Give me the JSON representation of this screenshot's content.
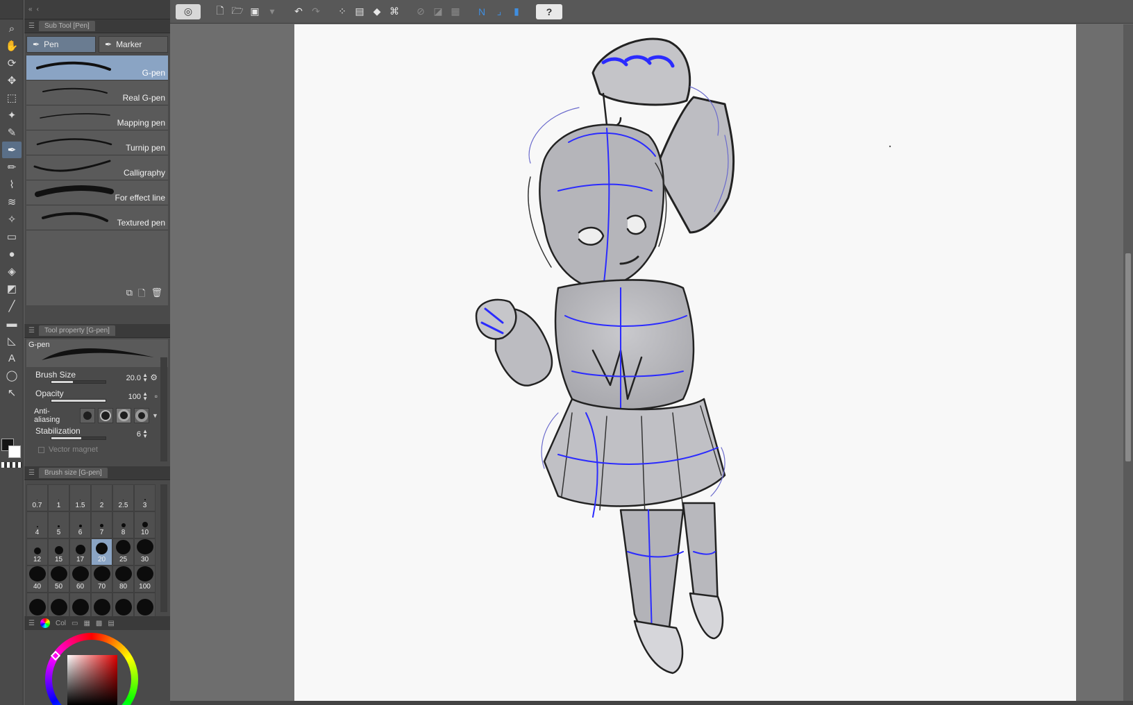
{
  "toolbar": {
    "tools": [
      {
        "name": "zoom-icon",
        "glyph": "⌕"
      },
      {
        "name": "hand-icon",
        "glyph": "✋"
      },
      {
        "name": "rotate-icon",
        "glyph": "⟳"
      },
      {
        "name": "move-icon",
        "glyph": "✥"
      },
      {
        "name": "selection-icon",
        "glyph": "⬚"
      },
      {
        "name": "auto-select-icon",
        "glyph": "✦"
      },
      {
        "name": "eyedropper-icon",
        "glyph": "✎"
      },
      {
        "name": "pen-icon",
        "glyph": "✒",
        "active": true
      },
      {
        "name": "pencil-icon",
        "glyph": "✏"
      },
      {
        "name": "brush-icon",
        "glyph": "⌇"
      },
      {
        "name": "airbrush-icon",
        "glyph": "≋"
      },
      {
        "name": "decoration-icon",
        "glyph": "✧"
      },
      {
        "name": "eraser-icon",
        "glyph": "▭"
      },
      {
        "name": "blend-icon",
        "glyph": "●"
      },
      {
        "name": "fill-icon",
        "glyph": "◈"
      },
      {
        "name": "gradient-icon",
        "glyph": "◩"
      },
      {
        "name": "figure-icon",
        "glyph": "╱"
      },
      {
        "name": "frame-icon",
        "glyph": "▬"
      },
      {
        "name": "ruler-icon",
        "glyph": "◺"
      },
      {
        "name": "text-icon",
        "glyph": "A"
      },
      {
        "name": "balloon-icon",
        "glyph": "◯"
      },
      {
        "name": "correct-line-icon",
        "glyph": "↖"
      }
    ]
  },
  "subtool": {
    "header": "Sub Tool [Pen]",
    "tabs": [
      {
        "label": "Pen",
        "active": true
      },
      {
        "label": "Marker",
        "active": false
      }
    ],
    "items": [
      {
        "label": "G-pen",
        "active": true
      },
      {
        "label": "Real G-pen",
        "active": false
      },
      {
        "label": "Mapping pen",
        "active": false
      },
      {
        "label": "Turnip pen",
        "active": false
      },
      {
        "label": "Calligraphy",
        "active": false
      },
      {
        "label": "For effect line",
        "active": false
      },
      {
        "label": "Textured pen",
        "active": false
      }
    ]
  },
  "toolprop": {
    "header": "Tool property [G-pen]",
    "preview_name": "G-pen",
    "brush_size": {
      "label": "Brush Size",
      "value": "20.0",
      "fill": 0.4
    },
    "opacity": {
      "label": "Opacity",
      "value": "100",
      "fill": 1.0
    },
    "antialiasing": {
      "label": "Anti-aliasing",
      "selected": 2
    },
    "stabilization": {
      "label": "Stabilization",
      "value": "6",
      "fill": 0.55
    },
    "vector_magnet": {
      "label": "Vector magnet"
    }
  },
  "brushsize": {
    "header": "Brush size [G-pen]",
    "selected": "20",
    "sizes": [
      {
        "label": "0.7",
        "d": 1
      },
      {
        "label": "1",
        "d": 1
      },
      {
        "label": "1.5",
        "d": 1
      },
      {
        "label": "2",
        "d": 1
      },
      {
        "label": "2.5",
        "d": 1
      },
      {
        "label": "3",
        "d": 2
      },
      {
        "label": "4",
        "d": 2
      },
      {
        "label": "5",
        "d": 3
      },
      {
        "label": "6",
        "d": 4
      },
      {
        "label": "7",
        "d": 5
      },
      {
        "label": "8",
        "d": 6
      },
      {
        "label": "10",
        "d": 8
      },
      {
        "label": "12",
        "d": 10
      },
      {
        "label": "15",
        "d": 12
      },
      {
        "label": "17",
        "d": 14
      },
      {
        "label": "20",
        "d": 17
      },
      {
        "label": "25",
        "d": 21
      },
      {
        "label": "30",
        "d": 24
      },
      {
        "label": "40",
        "d": 24
      },
      {
        "label": "50",
        "d": 24
      },
      {
        "label": "60",
        "d": 24
      },
      {
        "label": "70",
        "d": 24
      },
      {
        "label": "80",
        "d": 24
      },
      {
        "label": "100",
        "d": 24
      },
      {
        "label": "",
        "d": 24
      },
      {
        "label": "",
        "d": 24
      },
      {
        "label": "",
        "d": 24
      },
      {
        "label": "",
        "d": 24
      },
      {
        "label": "",
        "d": 24
      },
      {
        "label": "",
        "d": 24
      }
    ]
  },
  "colorwheel": {
    "header": "Col"
  },
  "commandbar": {
    "buttons": [
      {
        "name": "app-logo-icon",
        "glyph": "◎",
        "cls": "logo"
      },
      {
        "name": "new-file-icon",
        "glyph": "🗋"
      },
      {
        "name": "open-file-icon",
        "glyph": "🗁"
      },
      {
        "name": "save-icon",
        "glyph": "▣"
      },
      {
        "name": "save-dropdown-icon",
        "glyph": "▾",
        "cls": "dim"
      },
      {
        "name": "sep"
      },
      {
        "name": "undo-icon",
        "glyph": "↶"
      },
      {
        "name": "redo-icon",
        "glyph": "↷",
        "cls": "dim"
      },
      {
        "name": "sep"
      },
      {
        "name": "clear-selection-icon",
        "glyph": "⁘"
      },
      {
        "name": "clear-outside-icon",
        "glyph": "▤"
      },
      {
        "name": "fill-selection-icon",
        "glyph": "◆"
      },
      {
        "name": "transform-icon",
        "glyph": "⌘"
      },
      {
        "name": "sep"
      },
      {
        "name": "snap-ruler-icon",
        "glyph": "⊘",
        "cls": "dim"
      },
      {
        "name": "snap-special-icon",
        "glyph": "◪",
        "cls": "dim"
      },
      {
        "name": "snap-grid-icon",
        "glyph": "▦",
        "cls": "dim"
      },
      {
        "name": "sep"
      },
      {
        "name": "pressure-icon",
        "glyph": "N",
        "cls": "blue"
      },
      {
        "name": "pressure-curve-icon",
        "glyph": "⌟",
        "cls": "blue"
      },
      {
        "name": "stylus-icon",
        "glyph": "▮",
        "cls": "blue"
      },
      {
        "name": "help-icon",
        "glyph": "?",
        "cls": "help"
      }
    ]
  }
}
